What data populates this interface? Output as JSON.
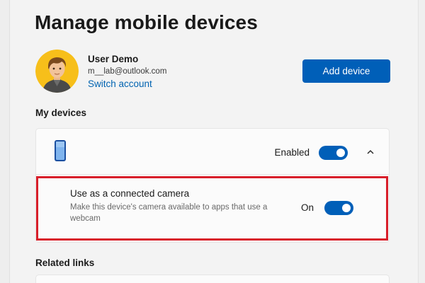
{
  "page": {
    "title": "Manage mobile devices"
  },
  "account": {
    "name": "User Demo",
    "email": "m__lab@outlook.com",
    "switch_label": "Switch account",
    "avatar_icon": "user-avatar-cartoon-icon"
  },
  "actions": {
    "add_device_label": "Add device"
  },
  "devices": {
    "heading": "My devices",
    "items": [
      {
        "icon": "smartphone-icon",
        "status_label": "Enabled",
        "enabled": true,
        "expanded": true,
        "settings": [
          {
            "title": "Use as a connected camera",
            "description": "Make this device's camera available to apps that use a webcam",
            "state_label": "On",
            "on": true,
            "highlighted": true
          }
        ]
      }
    ]
  },
  "related": {
    "heading": "Related links"
  },
  "colors": {
    "accent": "#005fb8",
    "link": "#0063b1",
    "highlight": "#d81e2a",
    "background": "#f3f3f3",
    "card": "#fbfbfb"
  }
}
